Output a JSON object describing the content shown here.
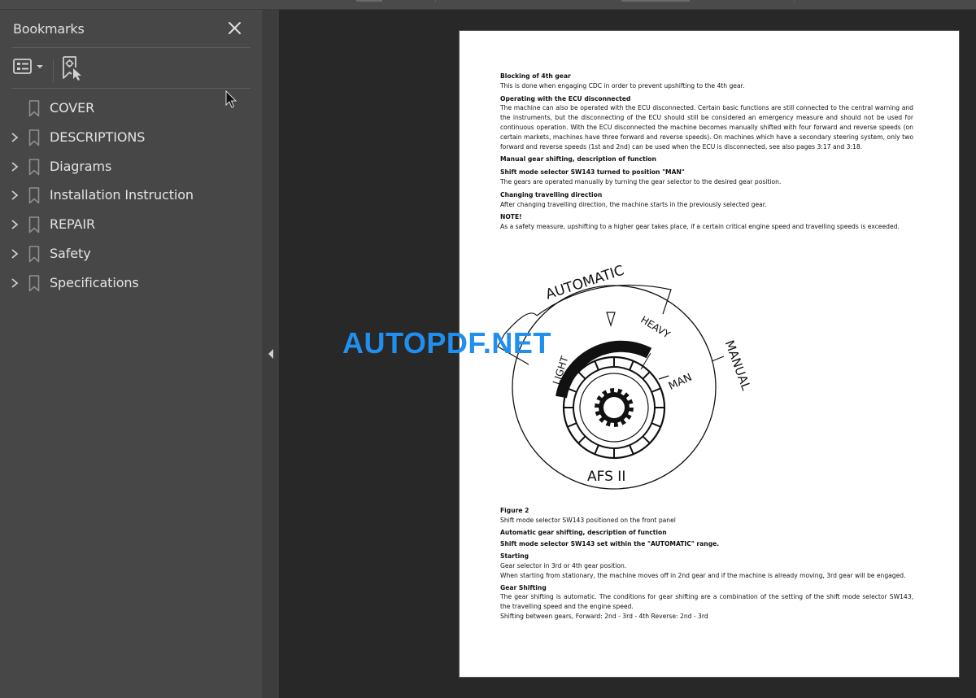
{
  "sidebar": {
    "title": "Bookmarks",
    "close_label": "Close",
    "toolbar": {
      "options_icon": "list-options-icon",
      "find_bookmark_icon": "find-current-bookmark-icon"
    },
    "items": [
      {
        "label": "COVER",
        "expandable": false
      },
      {
        "label": "DESCRIPTIONS",
        "expandable": true
      },
      {
        "label": "Diagrams",
        "expandable": true
      },
      {
        "label": "Installation Instruction",
        "expandable": true
      },
      {
        "label": "REPAIR",
        "expandable": true
      },
      {
        "label": "Safety",
        "expandable": true
      },
      {
        "label": "Specifications",
        "expandable": true
      }
    ]
  },
  "splitter": {
    "collapse_icon": "triangle-left-icon"
  },
  "document": {
    "sections_top": [
      {
        "type": "heading",
        "text": "Blocking of 4th gear"
      },
      {
        "type": "para",
        "text": "This is done when engaging CDC in order to prevent upshifting to the 4th gear."
      },
      {
        "type": "heading",
        "text": "Operating with the ECU disconnected"
      },
      {
        "type": "para",
        "text": "The machine can also be operated with the ECU disconnected. Certain basic functions are still connected to the central warning and the instruments, but the disconnecting of the ECU should still be considered an emergency measure and should not be used for continuous operation. With the ECU disconnected the machine becomes manually shifted with four forward and reverse speeds (on certain markets, machines have three forward and reverse speeds). On machines which have a secondary steering system, only two forward and reverse speeds (1st and 2nd) can be used when the ECU is disconnected, see also pages 3:17 and 3:18."
      },
      {
        "type": "heading",
        "text": "Manual gear shifting, description of function"
      },
      {
        "type": "heading",
        "text": "Shift mode selector SW143 turned to position \"MAN\""
      },
      {
        "type": "para",
        "text": "The gears are operated manually by turning the gear selector to the desired gear position."
      },
      {
        "type": "heading",
        "text": "Changing travelling direction"
      },
      {
        "type": "para",
        "text": "After changing travelling direction, the machine starts in the previously selected gear."
      },
      {
        "type": "heading",
        "text": "NOTE!"
      },
      {
        "type": "para",
        "text": "As a safety measure, upshifting to a higher gear takes place, if a certain critical engine speed and travelling speeds is exceeded."
      }
    ],
    "figure_labels": {
      "automatic": "AUTOMATIC",
      "manual": "MANUAL",
      "light": "LIGHT",
      "heavy": "HEAVY",
      "man": "MAN",
      "afs": "AFS II"
    },
    "sections_bottom": [
      {
        "type": "heading",
        "text": "Figure 2"
      },
      {
        "type": "para",
        "text": "Shift mode selector SW143 positioned on the front panel"
      },
      {
        "type": "heading",
        "text": "Automatic gear shifting, description of function"
      },
      {
        "type": "heading",
        "text": "Shift mode selector SW143 set within the \"AUTOMATIC\" range."
      },
      {
        "type": "heading",
        "text": "Starting"
      },
      {
        "type": "para",
        "text": "Gear selector in 3rd or 4th gear position."
      },
      {
        "type": "para",
        "text": "When starting from stationary, the machine moves off in 2nd gear and if the machine is already moving, 3rd gear will be engaged."
      },
      {
        "type": "heading",
        "text": "Gear Shifting"
      },
      {
        "type": "para",
        "text": "The gear shifting is automatic. The conditions for gear shifting are a combination of the setting of the shift mode selector SW143, the travelling speed and the engine speed."
      },
      {
        "type": "para",
        "text": "Shifting between gears, Forward: 2nd - 3rd - 4th Reverse: 2nd - 3rd"
      }
    ]
  },
  "watermark": "AUTOPDF.NET",
  "colors": {
    "sidebar_bg": "#474747",
    "viewer_bg": "#282828",
    "watermark": "#1f8ff0",
    "text_light": "#e4e4e4"
  }
}
